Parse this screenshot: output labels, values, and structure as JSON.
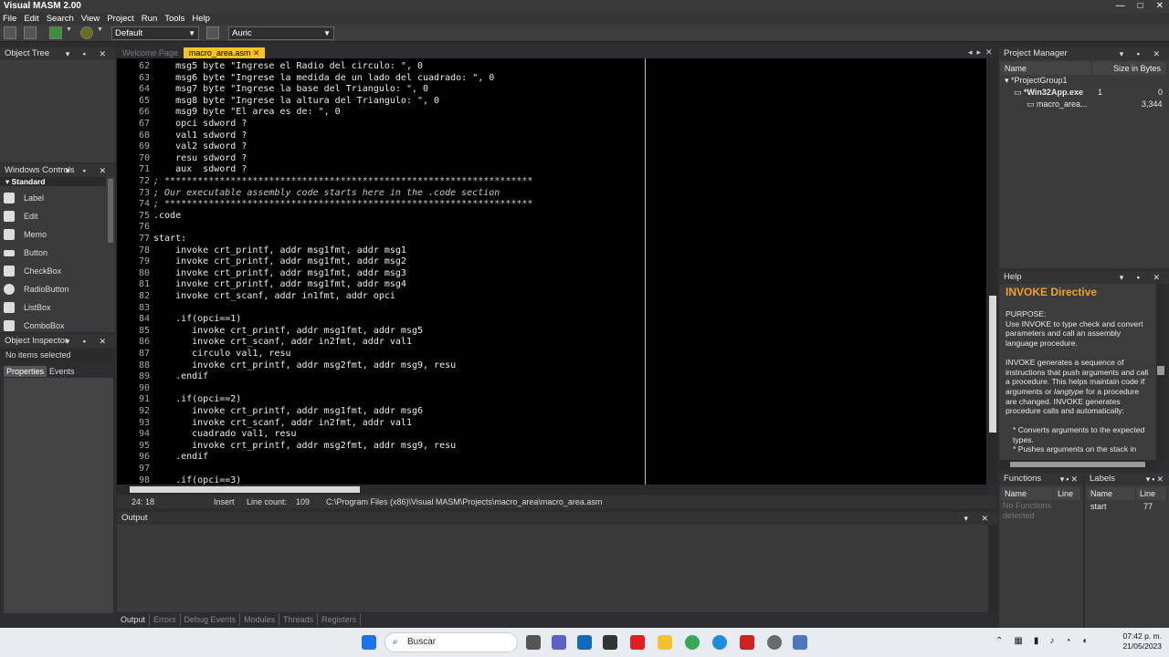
{
  "window": {
    "title": "Visual MASM 2.00"
  },
  "menu": [
    "File",
    "Edit",
    "Search",
    "View",
    "Project",
    "Run",
    "Tools",
    "Help"
  ],
  "toolbar": {
    "config_combo": "Default",
    "theme_combo": "Auric"
  },
  "object_tree": {
    "title": "Object Tree"
  },
  "windows_controls": {
    "title": "Windows Controls",
    "group": "Standard",
    "items": [
      "Label",
      "Edit",
      "Memo",
      "Button",
      "CheckBox",
      "RadioButton",
      "ListBox",
      "ComboBox"
    ]
  },
  "object_inspector": {
    "title": "Object Inspector",
    "selection": "No items selected",
    "tabs": [
      "Properties",
      "Events"
    ]
  },
  "editor": {
    "tabs": [
      "Welcome Page",
      "macro_area.asm"
    ],
    "lines": [
      {
        "n": "62",
        "t": "    msg5 byte \"Ingrese el Radio del circulo: \", 0"
      },
      {
        "n": "63",
        "t": "    msg6 byte \"Ingrese la medida de un lado del cuadrado: \", 0"
      },
      {
        "n": "64",
        "t": "    msg7 byte \"Ingrese la base del Triangulo: \", 0"
      },
      {
        "n": "65",
        "t": "    msg8 byte \"Ingrese la altura del Triangulo: \", 0"
      },
      {
        "n": "66",
        "t": "    msg9 byte \"El area es de: \", 0"
      },
      {
        "n": "67",
        "t": "    opci sdword ?"
      },
      {
        "n": "68",
        "t": "    val1 sdword ?"
      },
      {
        "n": "69",
        "t": "    val2 sdword ?"
      },
      {
        "n": "70",
        "t": "    resu sdword ?"
      },
      {
        "n": "71",
        "t": "    aux  sdword ?"
      },
      {
        "n": "72",
        "t": "; *******************************************************************",
        "c": true
      },
      {
        "n": "73",
        "t": "; Our executable assembly code starts here in the .code section",
        "c": true
      },
      {
        "n": "74",
        "t": "; *******************************************************************",
        "c": true
      },
      {
        "n": "75",
        "t": ".code"
      },
      {
        "n": "76",
        "t": ""
      },
      {
        "n": "77",
        "t": "start:"
      },
      {
        "n": "78",
        "t": "    invoke crt_printf, addr msg1fmt, addr msg1"
      },
      {
        "n": "79",
        "t": "    invoke crt_printf, addr msg1fmt, addr msg2"
      },
      {
        "n": "80",
        "t": "    invoke crt_printf, addr msg1fmt, addr msg3"
      },
      {
        "n": "81",
        "t": "    invoke crt_printf, addr msg1fmt, addr msg4"
      },
      {
        "n": "82",
        "t": "    invoke crt_scanf, addr in1fmt, addr opci"
      },
      {
        "n": "83",
        "t": ""
      },
      {
        "n": "84",
        "t": "    .if(opci==1)"
      },
      {
        "n": "85",
        "t": "       invoke crt_printf, addr msg1fmt, addr msg5"
      },
      {
        "n": "86",
        "t": "       invoke crt_scanf, addr in2fmt, addr val1"
      },
      {
        "n": "87",
        "t": "       circulo val1, resu"
      },
      {
        "n": "88",
        "t": "       invoke crt_printf, addr msg2fmt, addr msg9, resu"
      },
      {
        "n": "89",
        "t": "    .endif"
      },
      {
        "n": "90",
        "t": ""
      },
      {
        "n": "91",
        "t": "    .if(opci==2)"
      },
      {
        "n": "92",
        "t": "       invoke crt_printf, addr msg1fmt, addr msg6"
      },
      {
        "n": "93",
        "t": "       invoke crt_scanf, addr in2fmt, addr val1"
      },
      {
        "n": "94",
        "t": "       cuadrado val1, resu"
      },
      {
        "n": "95",
        "t": "       invoke crt_printf, addr msg2fmt, addr msg9, resu"
      },
      {
        "n": "96",
        "t": "    .endif"
      },
      {
        "n": "97",
        "t": ""
      },
      {
        "n": "98",
        "t": "    .if(opci==3)"
      }
    ]
  },
  "status": {
    "position": "24: 18",
    "mode": "Insert",
    "line_count_label": "Line count:",
    "line_count": "109",
    "path": "C:\\Program Files (x86)\\Visual MASM\\Projects\\macro_area\\macro_area.asm"
  },
  "output": {
    "title": "Output",
    "tabs": [
      "Output",
      "Errors",
      "Debug Events",
      "Modules",
      "Threads",
      "Registers"
    ]
  },
  "project_manager": {
    "title": "Project Manager",
    "col_name": "Name",
    "col_size": "Size in Bytes",
    "group": "*ProjectGroup1",
    "project": "*Win32App.exe",
    "project_count": "1",
    "project_size": "0",
    "file": "macro_area...",
    "file_size": "3,344"
  },
  "help": {
    "title": "Help",
    "heading": "INVOKE Directive",
    "purpose": "PURPOSE:",
    "p1": "Use INVOKE to type check and convert parameters and call an assembly language procedure.",
    "p2a": "INVOKE generates a sequence of instructions that push arguments and call a procedure. This helps maintain code if arguments or ",
    "p2em": "langtype",
    "p2b": " for a procedure are changed. INVOKE generates procedure calls and automatically:",
    "b1": "* Converts arguments to the expected types.",
    "b2": "* Pushes arguments on the stack in"
  },
  "functions": {
    "title": "Functions",
    "col_name": "Name",
    "col_line": "Line",
    "empty": "No Functions detected"
  },
  "labels": {
    "title": "Labels",
    "col_name": "Name",
    "col_line": "Line",
    "row_name": "start",
    "row_line": "77"
  },
  "taskbar": {
    "search": "Buscar",
    "time": "07:42 p. m.",
    "date": "21/05/2023"
  },
  "colors": {
    "accent_tab": "#f7c326",
    "help_heading": "#f0a030",
    "editor_bg": "#000000"
  }
}
